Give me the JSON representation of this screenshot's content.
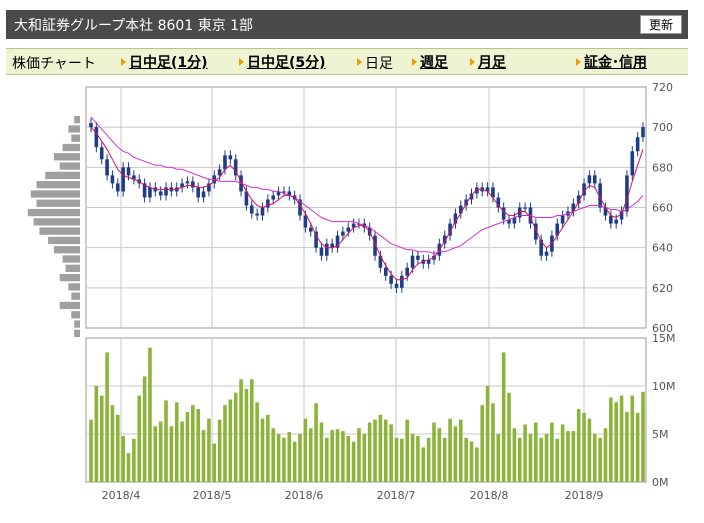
{
  "header": {
    "title": "大和証券グループ本社  8601  東京 1部",
    "update_button": "更新"
  },
  "nav": {
    "label": "株価チャート",
    "links": [
      "日中足(1分)",
      "日中足(5分)",
      "日足",
      "週足",
      "月足",
      "証金･信用"
    ],
    "active": "日足"
  },
  "colors": {
    "candle": "#1f3c8a",
    "ma_short": "#d4145a",
    "ma_long": "#cc33cc",
    "volume_bar": "#8cb43a",
    "volume_profile": "#a0a0a0",
    "grid": "#c8c8c8",
    "accent_arrow": "#e8a000"
  },
  "chart_data": [
    {
      "type": "candlestick",
      "title": "",
      "ylim": [
        600,
        720
      ],
      "yticks": [
        "600",
        "620",
        "640",
        "660",
        "680",
        "700",
        "720"
      ],
      "xticks": [
        "2018/4",
        "2018/5",
        "2018/6",
        "2018/7",
        "2018/8",
        "2018/9"
      ],
      "close": [
        700,
        690,
        684,
        676,
        672,
        668,
        680,
        676,
        674,
        672,
        665,
        670,
        668,
        666,
        670,
        668,
        670,
        672,
        673,
        670,
        665,
        668,
        672,
        676,
        679,
        686,
        684,
        676,
        668,
        661,
        657,
        656,
        660,
        664,
        666,
        668,
        668,
        666,
        664,
        656,
        650,
        648,
        640,
        636,
        642,
        640,
        646,
        648,
        650,
        652,
        652,
        650,
        646,
        636,
        630,
        626,
        622,
        620,
        626,
        630,
        636,
        634,
        632,
        634,
        636,
        642,
        646,
        652,
        657,
        661,
        664,
        667,
        670,
        668,
        670,
        665,
        660,
        654,
        652,
        655,
        660,
        660,
        652,
        644,
        636,
        638,
        646,
        652,
        656,
        658,
        662,
        666,
        672,
        676,
        672,
        660,
        656,
        652,
        654,
        658,
        676,
        688,
        695,
        700
      ],
      "ma_short": [
        700,
        697,
        693,
        689,
        684,
        679,
        676,
        675,
        674,
        673,
        671,
        670,
        669,
        669,
        669,
        669,
        669,
        670,
        671,
        671,
        670,
        670,
        671,
        673,
        675,
        679,
        681,
        678,
        673,
        668,
        664,
        661,
        660,
        661,
        662,
        664,
        666,
        666,
        665,
        661,
        657,
        652,
        646,
        642,
        640,
        640,
        641,
        644,
        647,
        650,
        651,
        651,
        648,
        642,
        636,
        631,
        627,
        624,
        624,
        625,
        629,
        632,
        633,
        634,
        635,
        639,
        643,
        648,
        653,
        657,
        662,
        666,
        669,
        669,
        668,
        665,
        661,
        658,
        656,
        656,
        658,
        658,
        655,
        649,
        643,
        640,
        642,
        646,
        650,
        654,
        658,
        663,
        668,
        671,
        670,
        665,
        660,
        656,
        655,
        657,
        664,
        673,
        681,
        689
      ],
      "ma_long": [
        705,
        702,
        699,
        696,
        693,
        690,
        688,
        687,
        685,
        684,
        683,
        682,
        681,
        681,
        680,
        680,
        679,
        679,
        678,
        677,
        676,
        675,
        674,
        674,
        673,
        673,
        673,
        673,
        672,
        671,
        670,
        670,
        669,
        669,
        668,
        668,
        667,
        666,
        665,
        663,
        661,
        659,
        657,
        655,
        654,
        653,
        653,
        653,
        653,
        653,
        652,
        651,
        650,
        648,
        646,
        644,
        642,
        641,
        640,
        639,
        639,
        638,
        638,
        638,
        637,
        638,
        638,
        639,
        640,
        641,
        643,
        645,
        647,
        649,
        650,
        651,
        652,
        653,
        654,
        655,
        656,
        656,
        656,
        655,
        655,
        655,
        655,
        656,
        656,
        657,
        658,
        659,
        660,
        661,
        661,
        661,
        660,
        659,
        659,
        658,
        659,
        661,
        663,
        666
      ]
    },
    {
      "type": "bar",
      "title": "",
      "ylim": [
        0,
        15
      ],
      "yticks": [
        "0M",
        "5M",
        "10M",
        "15M"
      ],
      "xticks": [
        "2018/4",
        "2018/5",
        "2018/6",
        "2018/7",
        "2018/8",
        "2018/9"
      ],
      "values": [
        6.5,
        10,
        9,
        13.5,
        8,
        7,
        4.8,
        3,
        4.5,
        9,
        11,
        14,
        5.8,
        6.3,
        8.5,
        5.8,
        8.3,
        6.3,
        7.3,
        8,
        7.6,
        5.4,
        6.6,
        4,
        6.5,
        8,
        8.6,
        9.3,
        10.7,
        9.7,
        10.7,
        8.3,
        6.6,
        7,
        5.6,
        5,
        4.6,
        5.2,
        4.2,
        5,
        6.6,
        5.6,
        8.2,
        6.2,
        4.6,
        5.4,
        5.5,
        5.3,
        4.8,
        4.2,
        5.6,
        5,
        6.2,
        6.5,
        7,
        6.5,
        6,
        4.6,
        4.5,
        6.5,
        5,
        4.8,
        3.6,
        4.6,
        6.2,
        5.6,
        4.6,
        6.6,
        5.8,
        6.5,
        4.6,
        4.2,
        3.6,
        8,
        10,
        8.2,
        5,
        13.5,
        9.3,
        5.6,
        4.6,
        6,
        5,
        6.2,
        4.6,
        5,
        6.2,
        4.5,
        6,
        5.3,
        5.3,
        7.6,
        7.2,
        6.6,
        5,
        4.6,
        5.6,
        8.8,
        8.3,
        9,
        7.3,
        9,
        7.2,
        9.4
      ],
      "volume_profile": [
        0.1,
        0.2,
        0.15,
        0.3,
        0.45,
        0.35,
        0.6,
        0.75,
        0.85,
        0.75,
        0.9,
        0.8,
        0.7,
        0.55,
        0.45,
        0.3,
        0.25,
        0.35,
        0.2,
        0.15,
        0.35,
        0.15,
        0.1,
        0.1
      ]
    }
  ]
}
